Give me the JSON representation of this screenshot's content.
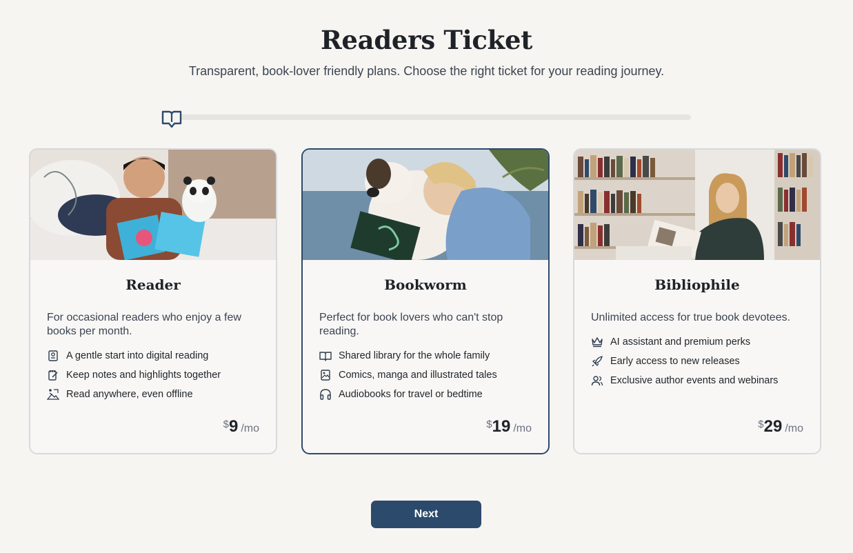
{
  "header": {
    "title": "Readers Ticket",
    "subtitle": "Transparent, book-lover friendly plans. Choose the right ticket for your reading journey."
  },
  "progress": {
    "icon": "book-open-icon",
    "value": 0.0
  },
  "plans": [
    {
      "name": "Reader",
      "description": "For occasional readers who enjoy a few books per month.",
      "features": [
        {
          "icon": "book-bookmark-icon",
          "text": "A gentle start into digital reading"
        },
        {
          "icon": "notebook-pen-icon",
          "text": "Keep notes and highlights together"
        },
        {
          "icon": "reading-outdoors-icon",
          "text": "Read anywhere, even offline"
        }
      ],
      "price": {
        "currency": "$",
        "amount": "9",
        "period": "/mo"
      },
      "selected": false
    },
    {
      "name": "Bookworm",
      "description": "Perfect for book lovers who can't stop reading.",
      "features": [
        {
          "icon": "book-open-icon",
          "text": "Shared library for the whole family"
        },
        {
          "icon": "image-book-icon",
          "text": "Comics, manga and illustrated tales"
        },
        {
          "icon": "headphones-icon",
          "text": "Audiobooks for travel or bedtime"
        }
      ],
      "price": {
        "currency": "$",
        "amount": "19",
        "period": "/mo"
      },
      "selected": true
    },
    {
      "name": "Bibliophile",
      "description": "Unlimited access for true book devotees.",
      "features": [
        {
          "icon": "crown-icon",
          "text": "AI assistant and premium perks"
        },
        {
          "icon": "rocket-icon",
          "text": "Early access to new releases"
        },
        {
          "icon": "users-icon",
          "text": "Exclusive author events and webinars"
        }
      ],
      "price": {
        "currency": "$",
        "amount": "29",
        "period": "/mo"
      },
      "selected": false
    }
  ],
  "footer": {
    "next_label": "Next"
  },
  "colors": {
    "accent": "#2c4a6b",
    "background": "#f7f5f2",
    "card_border": "#d7d9dc"
  }
}
